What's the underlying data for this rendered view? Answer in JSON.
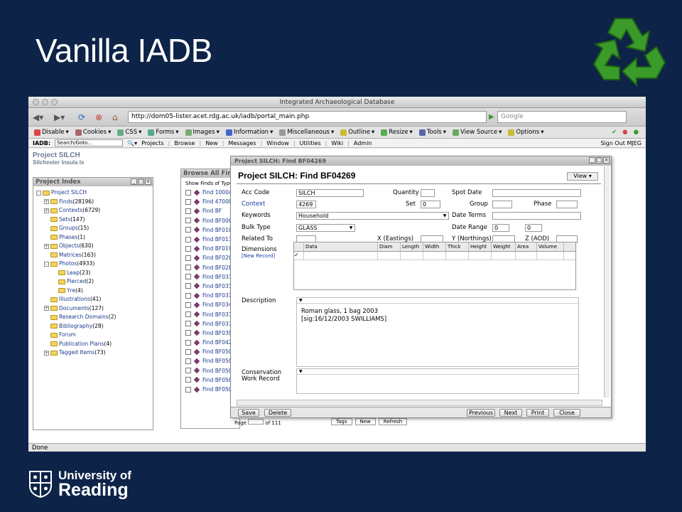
{
  "slide": {
    "title": "Vanilla IADB"
  },
  "logo": {
    "line1": "University of",
    "line2": "Reading"
  },
  "browser": {
    "window_title": "Integrated Archaeological Database",
    "url": "http://dom05-lister.acet.rdg.ac.uk/iadb/portal_main.php",
    "search_placeholder": "Google",
    "status": "Done",
    "webdev_toolbar": [
      "Disable",
      "Cookies",
      "CSS",
      "Forms",
      "Images",
      "Information",
      "Miscellaneous",
      "Outline",
      "Resize",
      "Tools",
      "View Source",
      "Options"
    ]
  },
  "iadb_bar": {
    "label": "IADB:",
    "search_value": "Search/Goto...",
    "links": [
      "Projects",
      "Browse",
      "New",
      "Messages",
      "Window",
      "Utilities",
      "Wiki",
      "Admin"
    ],
    "signout": "Sign Out MJEG"
  },
  "project": {
    "name": "Project SILCH",
    "subtitle": "Silchester Insula Ix"
  },
  "project_index": {
    "title": "Project Index",
    "items": [
      {
        "label": "Project SILCH",
        "count": "",
        "pm": "-"
      },
      {
        "label": "Finds",
        "count": "(28196)",
        "pm": "+"
      },
      {
        "label": "Contexts",
        "count": "(6729)",
        "pm": "+"
      },
      {
        "label": "Sets",
        "count": "(147)",
        "pm": ""
      },
      {
        "label": "Groups",
        "count": "(15)",
        "pm": ""
      },
      {
        "label": "Phases",
        "count": "(1)",
        "pm": ""
      },
      {
        "label": "Objects",
        "count": "(630)",
        "pm": "+"
      },
      {
        "label": "Matrices",
        "count": "(163)",
        "pm": ""
      },
      {
        "label": "Photos",
        "count": "(4933)",
        "pm": "-"
      },
      {
        "label": "Leap",
        "count": "(23)",
        "pm": ""
      },
      {
        "label": "Pierced",
        "count": "(2)",
        "pm": ""
      },
      {
        "label": "Yre",
        "count": "(4)",
        "pm": ""
      },
      {
        "label": "Illustrations",
        "count": "(41)",
        "pm": ""
      },
      {
        "label": "Documents",
        "count": "(127)",
        "pm": "+"
      },
      {
        "label": "Research Domains",
        "count": "(2)",
        "pm": ""
      },
      {
        "label": "Bibliography",
        "count": "(28)",
        "pm": ""
      },
      {
        "label": "Forum",
        "count": "",
        "pm": ""
      },
      {
        "label": "Publication Plans",
        "count": "(4)",
        "pm": ""
      },
      {
        "label": "Tagged Items",
        "count": "(73)",
        "pm": "+"
      }
    ]
  },
  "browse_finds": {
    "title": "Browse All Finds",
    "show_label": "Show Finds of Type",
    "rows": [
      "Find 10004",
      "Find 47000",
      "Find BF",
      "Find BF000",
      "Find BF010",
      "Find BF013",
      "Find BF019",
      "Find BF020",
      "Find BF028",
      "Find BF031",
      "Find BF031",
      "Find BF033",
      "Find BF034",
      "Find BF037",
      "Find BF037",
      "Find BF039",
      "Find BF042",
      "Find BF050",
      "Find BF050",
      "Find BF050",
      "Find BF050",
      "Find BF050"
    ],
    "pager": [
      "Page",
      "of 111"
    ],
    "buttons": [
      "Tags",
      "New",
      "Refresh"
    ]
  },
  "find_window": {
    "head": "Project SILCH: Find BF04269",
    "title": "Project SILCH: Find BF04269",
    "view_label": "View",
    "acc_code_label": "Acc Code",
    "acc_code": "SILCH",
    "quantity_label": "Quantity",
    "quantity": "",
    "spot_date_label": "Spot Date",
    "spot_date": "",
    "context_label": "Context",
    "context": "4269",
    "set_label": "Set",
    "set": "0",
    "group_label": "Group",
    "group": "",
    "phase_label": "Phase",
    "phase": "",
    "keywords_label": "Keywords",
    "keywords": "Household",
    "date_terms_label": "Date Terms",
    "date_terms": "",
    "bulk_type_label": "Bulk Type",
    "bulk_type": "GLASS",
    "date_range_label": "Date Range",
    "date_range_from": "0",
    "date_range_to": "0",
    "related_to_label": "Related To",
    "related_to": "",
    "x_label": "X (Eastings)",
    "y_label": "Y (Northings)",
    "z_label": "Z (AOD)",
    "dimensions_label": "Dimensions",
    "new_record_label": "[New Record]",
    "dim_columns": [
      "Data",
      "Diam",
      "Length",
      "Width",
      "Thick",
      "Height",
      "Weight",
      "Area",
      "Volume"
    ],
    "description_label": "Description",
    "description_line1": "Roman glass, 1 bag 2003",
    "description_line2": "[sig:16/12/2003 SWILLIAMS]",
    "conservation_label1": "Conservation",
    "conservation_label2": "Work Record",
    "buttons": {
      "save": "Save",
      "delete": "Delete",
      "previous": "Previous",
      "next": "Next",
      "print": "Print",
      "close": "Close"
    }
  }
}
